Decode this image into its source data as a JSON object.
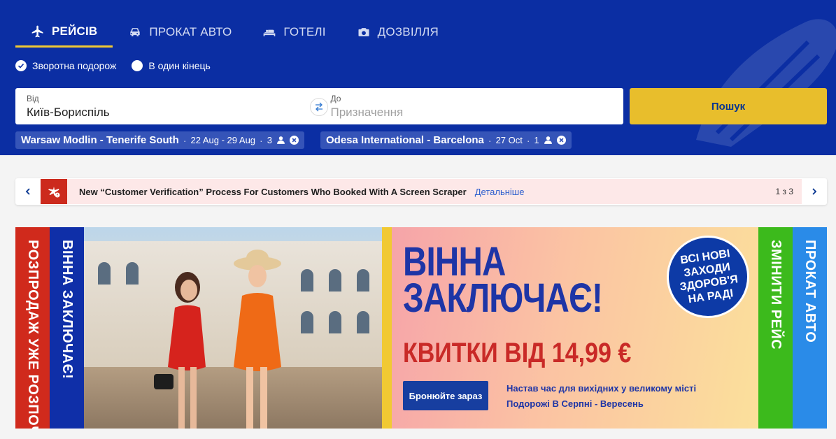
{
  "tabs": [
    {
      "label": "РЕЙСІВ",
      "icon": "plane-icon",
      "active": true
    },
    {
      "label": "ПРОКАТ АВТО",
      "icon": "car-icon",
      "active": false
    },
    {
      "label": "ГОТЕЛІ",
      "icon": "bed-icon",
      "active": false
    },
    {
      "label": "ДОЗВІЛЛЯ",
      "icon": "camera-icon",
      "active": false
    }
  ],
  "trip_type": {
    "return_label": "Зворотна подорож",
    "oneway_label": "В один кінець",
    "selected": "return"
  },
  "search": {
    "from_label": "Від",
    "from_value": "Київ-Бориспіль",
    "to_label": "До",
    "to_placeholder": "Призначення",
    "button_label": "Пошук"
  },
  "recent_searches": [
    {
      "route": "Warsaw Modlin - Tenerife South",
      "dates": "22 Aug - 29 Aug",
      "passengers": "3"
    },
    {
      "route": "Odesa International - Barcelona",
      "dates": "27 Oct",
      "passengers": "1"
    }
  ],
  "notice": {
    "text": "New “Customer Verification” Process For Customers Who Booked With A Screen Scraper",
    "link": "Детальніше",
    "counter": "1 з 3"
  },
  "banner": {
    "left_strip_1": "РОЗПРОДАЖ УЖЕ РОЗПОЧАВСЯ",
    "left_strip_2": "ВІННА ЗАКЛЮЧАЄ!",
    "title_line1": "ВІННА",
    "title_line2": "ЗАКЛЮЧАЄ!",
    "price": "КВИТКИ ВІД 14,99 €",
    "badge_line1": "ВСІ НОВІ",
    "badge_line2": "ЗАХОДИ",
    "badge_line3": "ЗДОРОВ'Я",
    "badge_line4": "НА РАДІ",
    "button_label": "Бронюйте зараз",
    "sub_line1": "Настав час для вихідних у великому місті",
    "sub_line2": "Подорожі В Серпні - Вересень",
    "right_strip_1": "ЗМІНИТИ РЕЙС",
    "right_strip_2": "ПРОКАТ АВТО"
  },
  "colors": {
    "brand_blue": "#0b2ea3",
    "accent_yellow": "#f1c933",
    "alert_red": "#cc2a1d",
    "strip_red": "#d02a1c",
    "strip_blue": "#0f2fa8",
    "strip_green": "#3cba1c",
    "strip_lightblue": "#2a8be8"
  }
}
